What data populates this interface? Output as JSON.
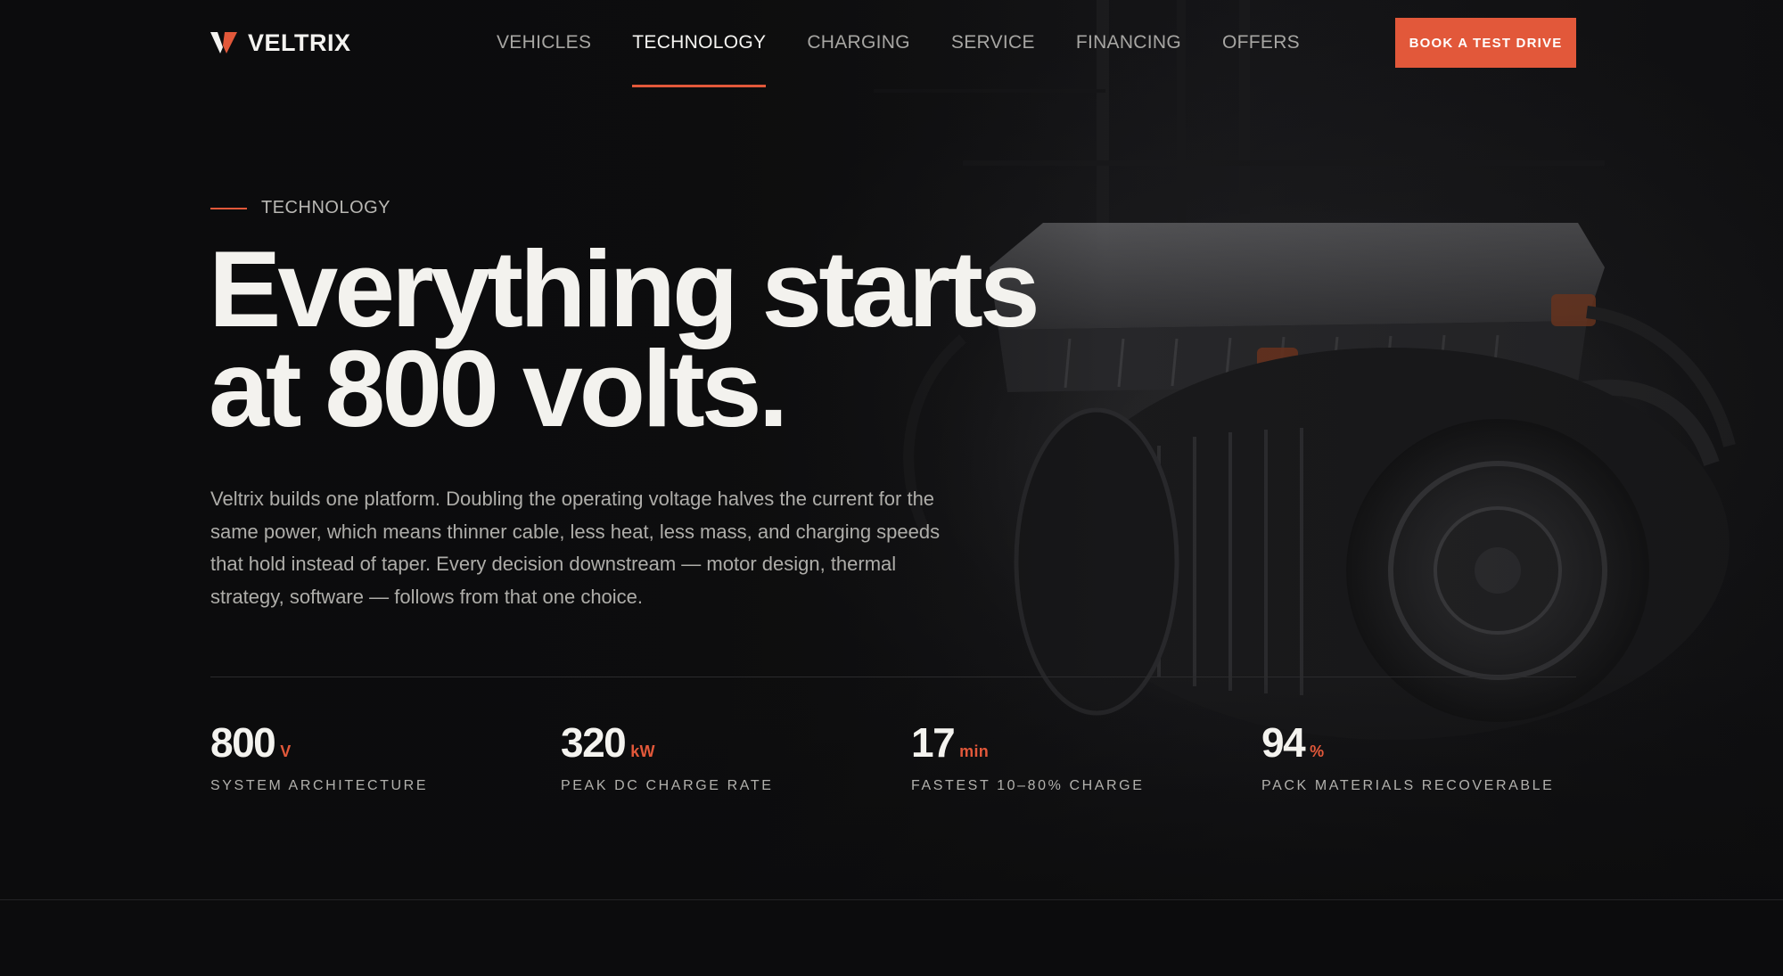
{
  "brand": {
    "name": "VELTRIX",
    "accent_color": "#e2583a",
    "logo_icon": "v-mark-icon"
  },
  "nav": {
    "links": [
      {
        "label": "VEHICLES",
        "active": false
      },
      {
        "label": "TECHNOLOGY",
        "active": true
      },
      {
        "label": "CHARGING",
        "active": false
      },
      {
        "label": "SERVICE",
        "active": false
      },
      {
        "label": "FINANCING",
        "active": false
      },
      {
        "label": "OFFERS",
        "active": false
      }
    ],
    "cta_label": "BOOK A TEST DRIVE"
  },
  "hero": {
    "eyebrow": "TECHNOLOGY",
    "headline_line1": "Everything starts",
    "headline_line2": "at 800 volts.",
    "lead": "Veltrix builds one platform. Doubling the operating voltage halves the current for the same power, which means thinner cable, less heat, less mass, and charging speeds that hold instead of taper. Every decision downstream — motor design, thermal strategy, software — follows from that one choice."
  },
  "stats": [
    {
      "value": "800",
      "unit": "V",
      "label": "SYSTEM ARCHITECTURE"
    },
    {
      "value": "320",
      "unit": "kW",
      "label": "PEAK DC CHARGE RATE"
    },
    {
      "value": "17",
      "unit": "min",
      "label": "FASTEST 10–80% CHARGE"
    },
    {
      "value": "94",
      "unit": "%",
      "label": "PACK MATERIALS RECOVERABLE"
    }
  ]
}
